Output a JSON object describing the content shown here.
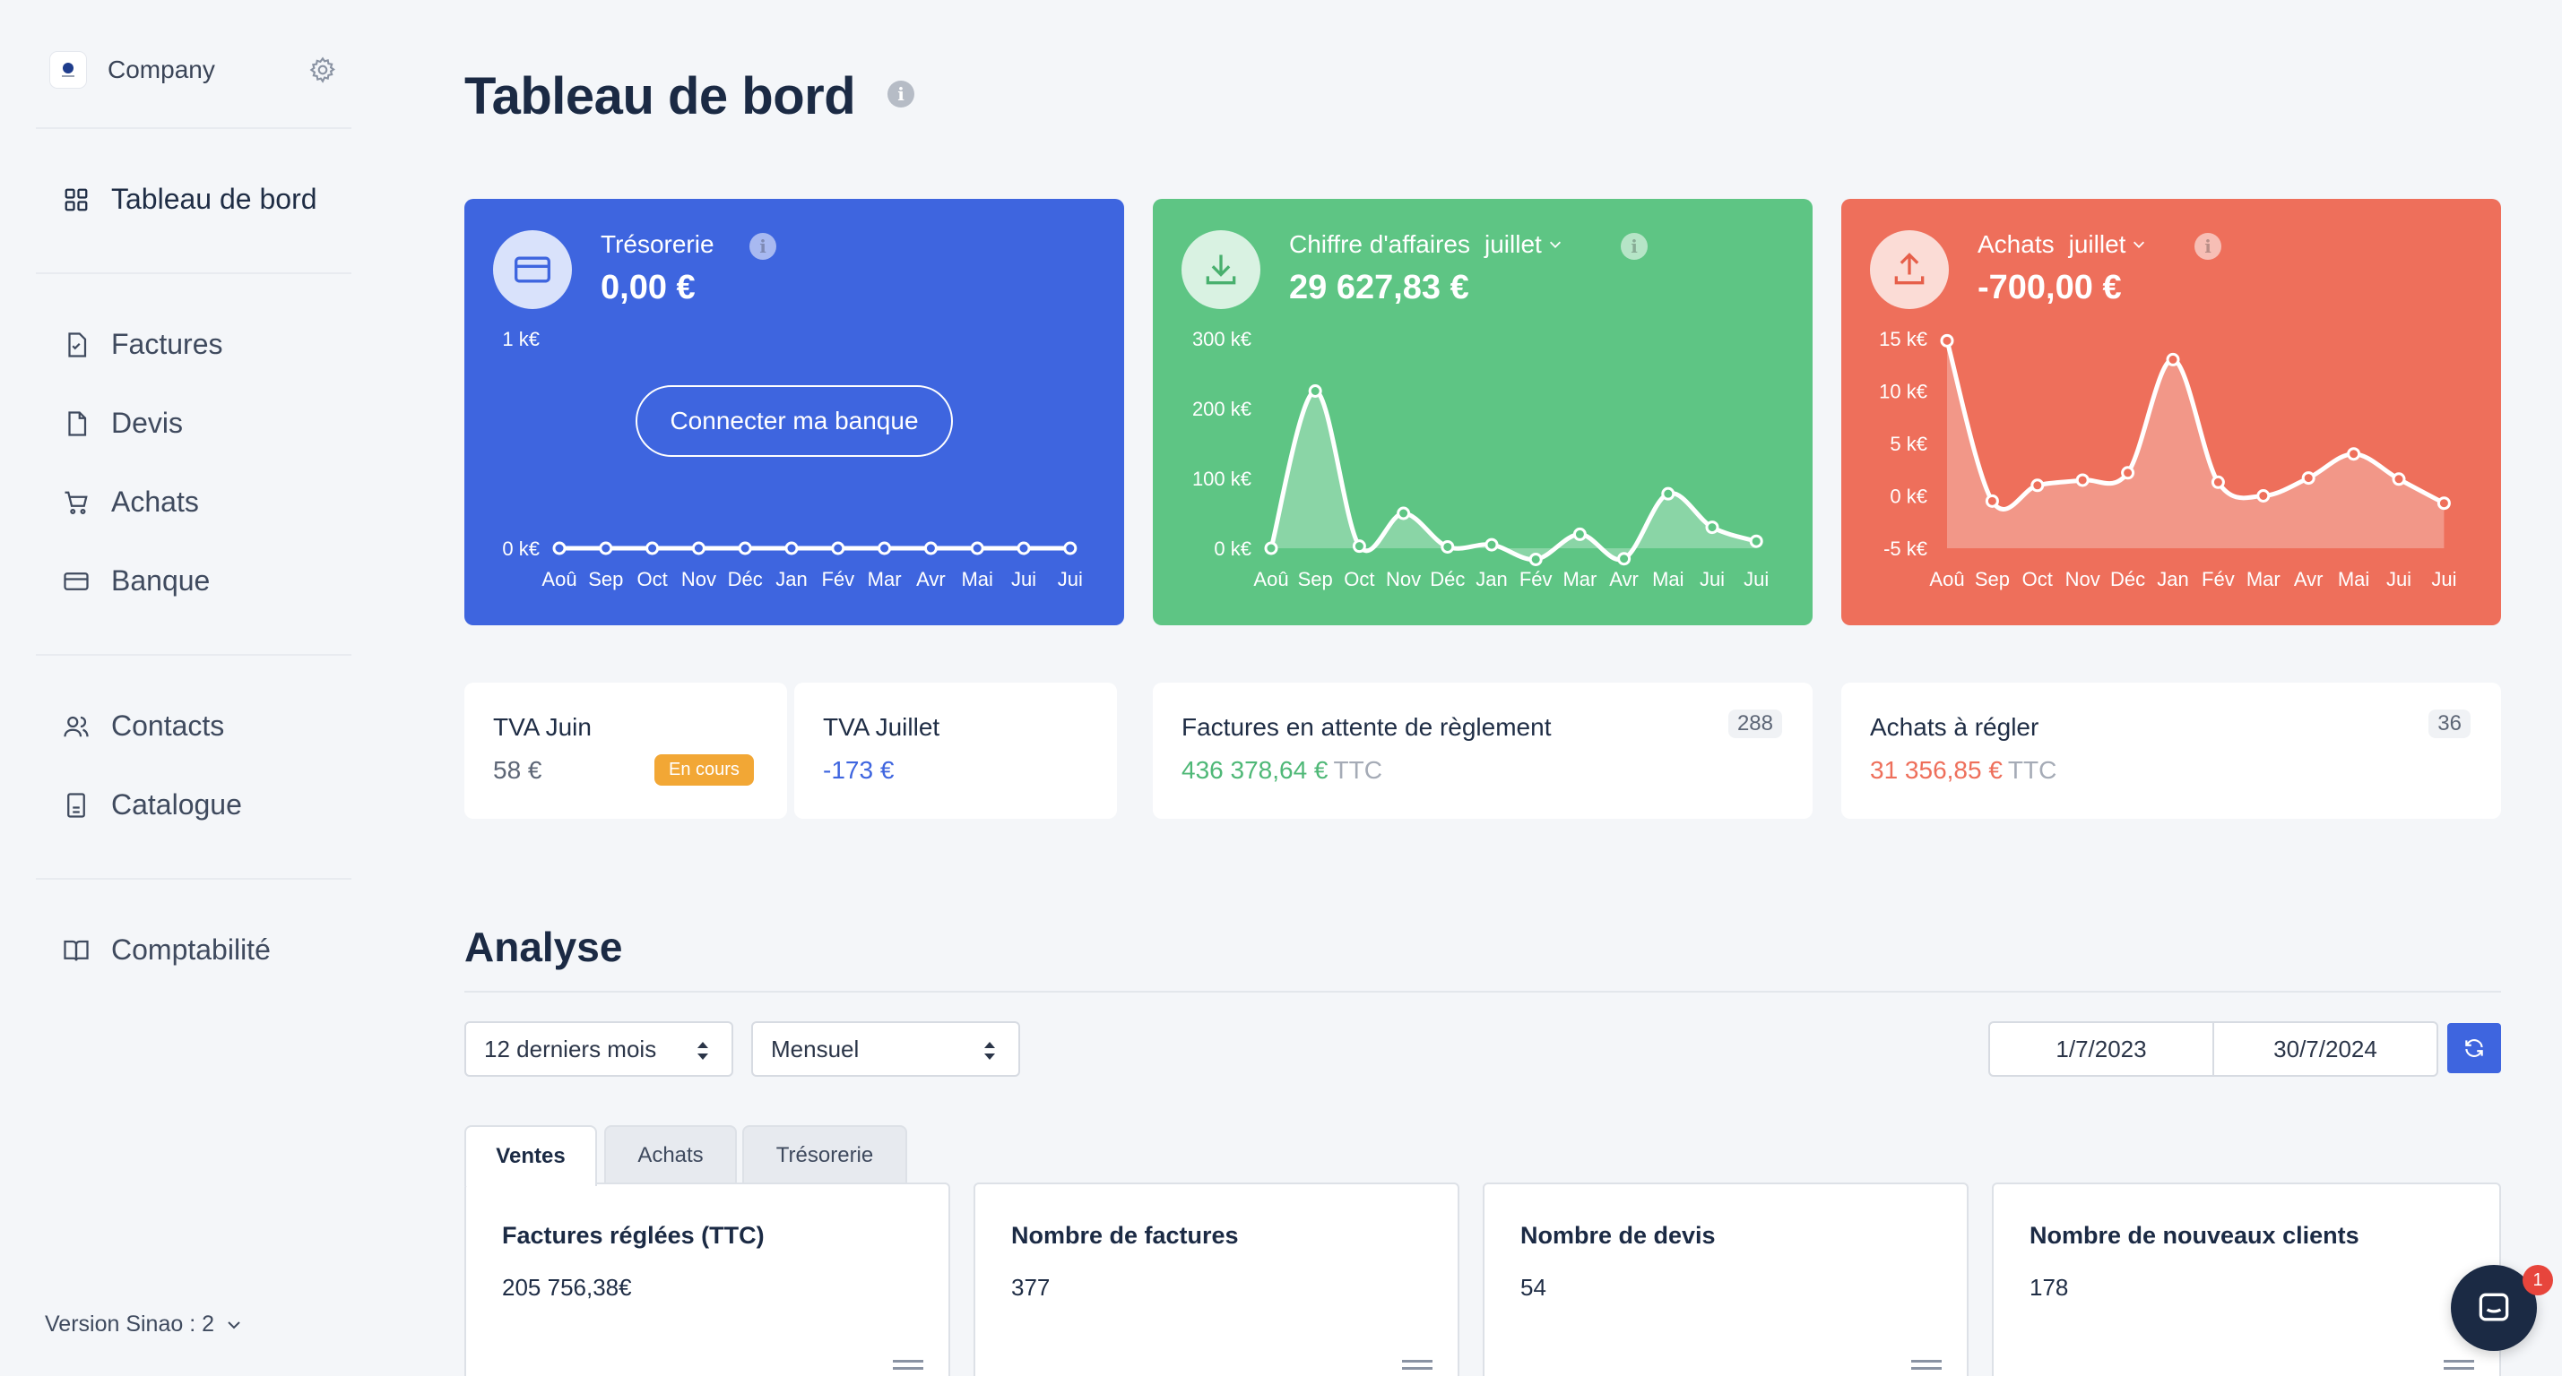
{
  "sidebar": {
    "company": "Company",
    "nav": {
      "dashboard": "Tableau de bord",
      "invoices": "Factures",
      "quotes": "Devis",
      "purchases": "Achats",
      "bank": "Banque",
      "contacts": "Contacts",
      "catalog": "Catalogue",
      "accounting": "Comptabilité"
    },
    "version": "Version Sinao : 2"
  },
  "page": {
    "title": "Tableau de bord"
  },
  "cards": {
    "treasury": {
      "label": "Trésorerie",
      "value": "0,00 €",
      "button": "Connecter ma banque",
      "color": "#3e65df"
    },
    "revenue": {
      "label": "Chiffre d'affaires",
      "month": "juillet",
      "value": "29 627,83 €",
      "color": "#5ec584"
    },
    "purchases": {
      "label": "Achats",
      "month": "juillet",
      "value": "-700,00 €",
      "color": "#ee6f5b"
    }
  },
  "chart_data": [
    {
      "type": "line",
      "x": [
        "Aoû",
        "Sep",
        "Oct",
        "Nov",
        "Déc",
        "Jan",
        "Fév",
        "Mar",
        "Avr",
        "Mai",
        "Jui",
        "Jui"
      ],
      "y_ticks": [
        "1 k€",
        "0 k€"
      ],
      "ylim": [
        0,
        1
      ],
      "series": [
        {
          "values": [
            0,
            0,
            0,
            0,
            0,
            0,
            0,
            0,
            0,
            0,
            0,
            0
          ]
        }
      ]
    },
    {
      "type": "area",
      "x": [
        "Aoû",
        "Sep",
        "Oct",
        "Nov",
        "Déc",
        "Jan",
        "Fév",
        "Mar",
        "Avr",
        "Mai",
        "Jui",
        "Jui"
      ],
      "y_ticks": [
        "300 k€",
        "200 k€",
        "100 k€",
        "0 k€"
      ],
      "ylim": [
        0,
        300
      ],
      "series": [
        {
          "values": [
            0,
            225,
            3,
            50,
            2,
            5,
            -16,
            20,
            -15,
            78,
            30,
            10
          ]
        }
      ]
    },
    {
      "type": "area",
      "x": [
        "Aoû",
        "Sep",
        "Oct",
        "Nov",
        "Déc",
        "Jan",
        "Fév",
        "Mar",
        "Avr",
        "Mai",
        "Jui",
        "Jui"
      ],
      "y_ticks": [
        "15 k€",
        "10 k€",
        "5 k€",
        "0 k€",
        "-5 k€"
      ],
      "ylim": [
        -5,
        15
      ],
      "series": [
        {
          "values": [
            14.8,
            -0.5,
            1,
            1.5,
            2.2,
            13,
            1.3,
            0,
            1.7,
            4,
            1.6,
            -0.7
          ]
        }
      ]
    }
  ],
  "stats": {
    "tva_june": {
      "title": "TVA Juin",
      "value": "58 €",
      "badge": "En cours"
    },
    "tva_july": {
      "title": "TVA Juillet",
      "value": "-173 €"
    },
    "pending_invoices": {
      "title": "Factures en attente de règlement",
      "count": "288",
      "value": "436 378,64 €",
      "suffix": "TTC"
    },
    "to_pay": {
      "title": "Achats à régler",
      "count": "36",
      "value": "31 356,85 €",
      "suffix": "TTC"
    }
  },
  "analysis": {
    "title": "Analyse",
    "period_select": "12 derniers mois",
    "granularity_select": "Mensuel",
    "date_from": "1/7/2023",
    "date_to": "30/7/2024",
    "tabs": [
      "Ventes",
      "Achats",
      "Trésorerie"
    ],
    "kpis": [
      {
        "title": "Factures réglées (TTC)",
        "value": "205 756,38€"
      },
      {
        "title": "Nombre de factures",
        "value": "377"
      },
      {
        "title": "Nombre de devis",
        "value": "54"
      },
      {
        "title": "Nombre de nouveaux clients",
        "value": "178"
      }
    ]
  },
  "chat": {
    "badge": "1"
  }
}
